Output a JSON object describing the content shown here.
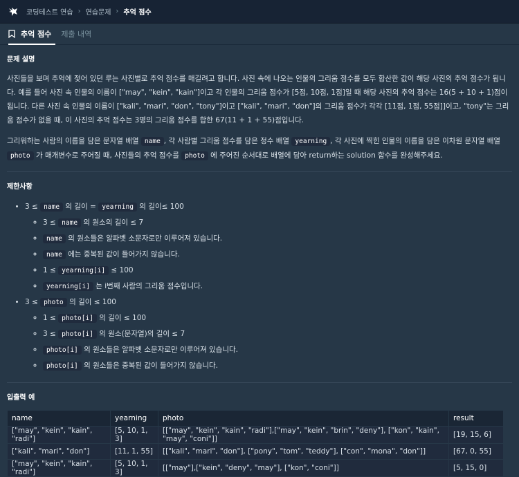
{
  "breadcrumb": [
    "코딩테스트 연습",
    "연습문제",
    "추억 점수"
  ],
  "tabs": {
    "active": "추억 점수",
    "inactive": "제출 내역"
  },
  "section1": {
    "title": "문제 설명",
    "p1": "사진들을 보며 추억에 젖어 있던 루는 사진별로 추억 점수를 매길려고 합니다. 사진 속에 나오는 인물의 그리움 점수를 모두 합산한 값이 해당 사진의 추억 점수가 됩니다. 예를 들어 사진 속 인물의 이름이 [\"may\", \"kein\", \"kain\"]이고 각 인물의 그리움 점수가 [5점, 10점, 1점]일 때 해당 사진의 추억 점수는 16(5 + 10 + 1)점이 됩니다. 다른 사진 속 인물의 이름이 [\"kali\", \"mari\", \"don\", \"tony\"]이고 [\"kali\", \"mari\", \"don\"]의 그리움 점수가 각각 [11점, 1점, 55점]]이고, \"tony\"는 그리움 점수가 없을 때, 이 사진의 추억 점수는 3명의 그리움 점수를 합한 67(11 + 1 + 55)점입니다.",
    "p2_a": "그리워하는 사람의 이름을 담은 문자열 배열 ",
    "p2_code1": "name",
    "p2_b": ", 각 사람별 그리움 점수를 담은 정수 배열 ",
    "p2_code2": "yearning",
    "p2_c": ", 각 사진에 찍힌 인물의 이름을 담은 이차원 문자열 배열 ",
    "p2_code3": "photo",
    "p2_d": " 가 매개변수로 주어질 때, 사진들의 추억 점수를 ",
    "p2_code4": "photo",
    "p2_e": " 에 주어진 순서대로 배열에 담아 return하는 solution 함수를 완성해주세요."
  },
  "section2": {
    "title": "제한사항",
    "items": [
      {
        "pre": "3 ≤ ",
        "c1": "name",
        "mid": " 의 길이 = ",
        "c2": "yearning",
        "post": " 의 길이≤ 100"
      },
      {
        "pre": "3 ≤ ",
        "c1": "name",
        "post": " 의 원소의 길이 ≤ 7"
      },
      {
        "c1": "name",
        "post": " 의 원소들은 알파벳 소문자로만 이루어져 있습니다."
      },
      {
        "c1": "name",
        "post": " 에는 중복된 값이 들어가지 않습니다."
      },
      {
        "pre": "1 ≤ ",
        "c1": "yearning[i]",
        "post": " ≤ 100"
      },
      {
        "c1": "yearning[i]",
        "post": " 는 i번째 사람의 그리움 점수입니다."
      },
      {
        "pre": "3 ≤ ",
        "c1": "photo",
        "post": " 의 길이 ≤ 100"
      },
      {
        "pre": "1 ≤ ",
        "c1": "photo[i]",
        "post": " 의 길이 ≤ 100"
      },
      {
        "pre": "3 ≤ ",
        "c1": "photo[i]",
        "post": " 의 원소(문자열)의 길이 ≤ 7"
      },
      {
        "c1": "photo[i]",
        "post": " 의 원소들은 알파벳 소문자로만 이루어져 있습니다."
      },
      {
        "c1": "photo[i]",
        "post": " 의 원소들은 중복된 값이 들어가지 않습니다."
      }
    ]
  },
  "section3": {
    "title": "입출력 예",
    "headers": [
      "name",
      "yearning",
      "photo",
      "result"
    ],
    "rows": [
      [
        "[\"may\", \"kein\", \"kain\", \"radi\"]",
        "[5, 10, 1, 3]",
        "[[\"may\", \"kein\", \"kain\", \"radi\"],[\"may\", \"kein\", \"brin\", \"deny\"], [\"kon\", \"kain\", \"may\", \"coni\"]]",
        "[19, 15, 6]"
      ],
      [
        "[\"kali\", \"mari\", \"don\"]",
        "[11, 1, 55]",
        "[[\"kali\", \"mari\", \"don\"], [\"pony\", \"tom\", \"teddy\"], [\"con\", \"mona\", \"don\"]]",
        "[67, 0, 55]"
      ],
      [
        "[\"may\", \"kein\", \"kain\", \"radi\"]",
        "[5, 10, 1, 3]",
        "[[\"may\"],[\"kein\", \"deny\", \"may\"], [\"kon\", \"coni\"]]",
        "[5, 15, 0]"
      ]
    ]
  }
}
